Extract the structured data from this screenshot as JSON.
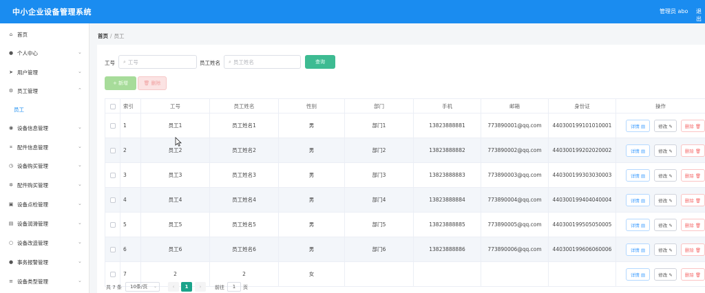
{
  "header": {
    "title": "中小企业设备管理系统",
    "user_label": "管理员 abo",
    "logout_label": "退出"
  },
  "sidebar": {
    "items": [
      {
        "label": "首页",
        "icon": "home-icon",
        "glyph": "⌂",
        "chevron": false
      },
      {
        "label": "个人中心",
        "icon": "user-icon",
        "glyph": "●",
        "chevron": true
      },
      {
        "label": "用户管理",
        "icon": "send-icon",
        "glyph": "➤",
        "chevron": true
      },
      {
        "label": "员工管理",
        "icon": "settings-icon",
        "glyph": "⚙",
        "chevron": true,
        "expanded": true
      },
      {
        "label": "员工",
        "sub": true
      },
      {
        "label": "设备信息管理",
        "icon": "location-icon",
        "glyph": "◉",
        "chevron": true
      },
      {
        "label": "配件信息管理",
        "icon": "crop-icon",
        "glyph": "⌗",
        "chevron": true
      },
      {
        "label": "设备购买管理",
        "icon": "clock-icon",
        "glyph": "◷",
        "chevron": true
      },
      {
        "label": "配件购买管理",
        "icon": "gear-icon",
        "glyph": "✲",
        "chevron": true
      },
      {
        "label": "设备点检管理",
        "icon": "bag-icon",
        "glyph": "▣",
        "chevron": true
      },
      {
        "label": "设备润滑管理",
        "icon": "box-icon",
        "glyph": "▤",
        "chevron": true
      },
      {
        "label": "设备改造管理",
        "icon": "circle-icon",
        "glyph": "○",
        "chevron": true
      },
      {
        "label": "事务报警管理",
        "icon": "user-alert-icon",
        "glyph": "●",
        "chevron": true
      },
      {
        "label": "设备类型管理",
        "icon": "list-icon",
        "glyph": "≡",
        "chevron": true
      }
    ]
  },
  "breadcrumb": {
    "home": "首页",
    "separator": "/",
    "current": "员工"
  },
  "search": {
    "id_label": "工号",
    "id_placeholder": "工号",
    "name_label": "员工姓名",
    "name_placeholder": "员工姓名",
    "search_button": "查询"
  },
  "actions": {
    "add": "+ 新增",
    "delete": "删除"
  },
  "table": {
    "headers": [
      "索引",
      "工号",
      "员工姓名",
      "性别",
      "部门",
      "手机",
      "邮箱",
      "身份证",
      "操作"
    ],
    "op_labels": {
      "detail": "详情 ▤",
      "edit": "修改 ✎",
      "delete": "删除 🗑"
    },
    "rows": [
      {
        "index": "1",
        "id": "员工1",
        "name": "员工姓名1",
        "gender": "男",
        "dept": "部门1",
        "phone": "13823888881",
        "email": "773890001@qq.com",
        "idcard": "440300199101010001"
      },
      {
        "index": "2",
        "id": "员工2",
        "name": "员工姓名2",
        "gender": "男",
        "dept": "部门2",
        "phone": "13823888882",
        "email": "773890002@qq.com",
        "idcard": "440300199202020002"
      },
      {
        "index": "3",
        "id": "员工3",
        "name": "员工姓名3",
        "gender": "男",
        "dept": "部门3",
        "phone": "13823888883",
        "email": "773890003@qq.com",
        "idcard": "440300199303030003"
      },
      {
        "index": "4",
        "id": "员工4",
        "name": "员工姓名4",
        "gender": "男",
        "dept": "部门4",
        "phone": "13823888884",
        "email": "773890004@qq.com",
        "idcard": "440300199404040004"
      },
      {
        "index": "5",
        "id": "员工5",
        "name": "员工姓名5",
        "gender": "男",
        "dept": "部门5",
        "phone": "13823888885",
        "email": "773890005@qq.com",
        "idcard": "440300199505050005"
      },
      {
        "index": "6",
        "id": "员工6",
        "name": "员工姓名6",
        "gender": "男",
        "dept": "部门6",
        "phone": "13823888886",
        "email": "773890006@qq.com",
        "idcard": "440300199606060006"
      },
      {
        "index": "7",
        "id": "2",
        "name": "2",
        "gender": "女",
        "dept": "",
        "phone": "",
        "email": "",
        "idcard": ""
      }
    ]
  },
  "pagination": {
    "total": "共 7 条",
    "page_size": "10条/页",
    "prev": "‹",
    "current": "1",
    "next": "›",
    "goto_label": "前往",
    "goto_value": "1",
    "page_suffix": "页"
  },
  "colors": {
    "header_bg": "#1a8cf0",
    "search_btn": "#3dbb92",
    "active_page": "#1aa38a"
  }
}
